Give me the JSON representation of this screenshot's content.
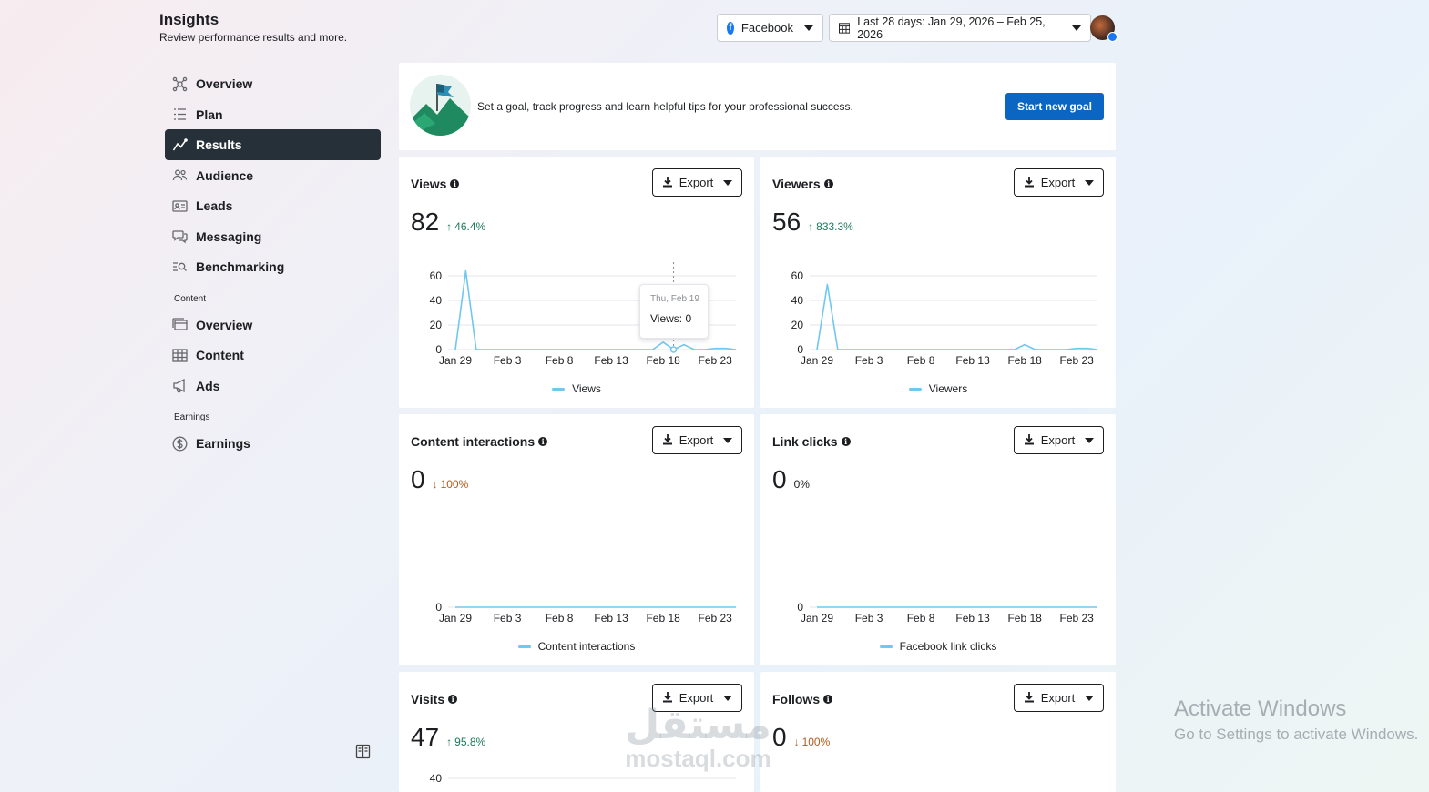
{
  "header": {
    "title": "Insights",
    "subtitle": "Review performance results and more.",
    "platform": "Facebook",
    "date_range": "Last 28 days: Jan 29, 2026 – Feb 25, 2026"
  },
  "sidebar": {
    "items": [
      {
        "label": "Overview",
        "icon": "overview-icon"
      },
      {
        "label": "Plan",
        "icon": "plan-icon"
      },
      {
        "label": "Results",
        "icon": "results-icon",
        "active": true
      },
      {
        "label": "Audience",
        "icon": "audience-icon"
      },
      {
        "label": "Leads",
        "icon": "leads-icon"
      },
      {
        "label": "Messaging",
        "icon": "messaging-icon"
      },
      {
        "label": "Benchmarking",
        "icon": "benchmarking-icon"
      }
    ],
    "content_section": "Content",
    "content_items": [
      {
        "label": "Overview",
        "icon": "content-overview-icon"
      },
      {
        "label": "Content",
        "icon": "table-icon"
      },
      {
        "label": "Ads",
        "icon": "megaphone-icon"
      }
    ],
    "earnings_section": "Earnings",
    "earnings_items": [
      {
        "label": "Earnings",
        "icon": "dollar-icon"
      }
    ]
  },
  "goal": {
    "text": "Set a goal, track progress and learn helpful tips for your professional success.",
    "button": "Start new goal"
  },
  "export_label": "Export",
  "metrics": {
    "views": {
      "title": "Views",
      "value": "82",
      "delta": "46.4%",
      "direction": "up",
      "legend": "Views",
      "tooltip": {
        "date": "Thu, Feb 19",
        "text": "Views: 0"
      }
    },
    "viewers": {
      "title": "Viewers",
      "value": "56",
      "delta": "833.3%",
      "direction": "up",
      "legend": "Viewers"
    },
    "content_interactions": {
      "title": "Content interactions",
      "value": "0",
      "delta": "100%",
      "direction": "down",
      "legend": "Content interactions"
    },
    "link_clicks": {
      "title": "Link clicks",
      "value": "0",
      "delta": "0%",
      "direction": "flat",
      "legend": "Facebook link clicks"
    },
    "visits": {
      "title": "Visits",
      "value": "47",
      "delta": "95.8%",
      "direction": "up"
    },
    "follows": {
      "title": "Follows",
      "value": "0",
      "delta": "100%",
      "direction": "down"
    }
  },
  "chart_data": [
    {
      "type": "line",
      "title": "Views",
      "x": [
        "Jan 29",
        "Jan 30",
        "Jan 31",
        "Feb 1",
        "Feb 2",
        "Feb 3",
        "Feb 4",
        "Feb 5",
        "Feb 6",
        "Feb 7",
        "Feb 8",
        "Feb 9",
        "Feb 10",
        "Feb 11",
        "Feb 12",
        "Feb 13",
        "Feb 14",
        "Feb 15",
        "Feb 16",
        "Feb 17",
        "Feb 18",
        "Feb 19",
        "Feb 20",
        "Feb 21",
        "Feb 22",
        "Feb 23",
        "Feb 24",
        "Feb 25"
      ],
      "tick_labels": [
        "Jan 29",
        "Feb 3",
        "Feb 8",
        "Feb 13",
        "Feb 18",
        "Feb 23"
      ],
      "series": [
        {
          "name": "Views",
          "values": [
            0,
            64,
            0,
            0,
            0,
            0,
            0,
            0,
            0,
            0,
            0,
            0,
            0,
            0,
            0,
            0,
            0,
            0,
            0,
            0,
            6,
            0,
            4,
            0,
            0,
            1,
            1,
            0
          ]
        }
      ],
      "ylim": [
        0,
        60
      ],
      "yticks": [
        0,
        20,
        40,
        60
      ]
    },
    {
      "type": "line",
      "title": "Viewers",
      "x": [
        "Jan 29",
        "Jan 30",
        "Jan 31",
        "Feb 1",
        "Feb 2",
        "Feb 3",
        "Feb 4",
        "Feb 5",
        "Feb 6",
        "Feb 7",
        "Feb 8",
        "Feb 9",
        "Feb 10",
        "Feb 11",
        "Feb 12",
        "Feb 13",
        "Feb 14",
        "Feb 15",
        "Feb 16",
        "Feb 17",
        "Feb 18",
        "Feb 19",
        "Feb 20",
        "Feb 21",
        "Feb 22",
        "Feb 23",
        "Feb 24",
        "Feb 25"
      ],
      "tick_labels": [
        "Jan 29",
        "Feb 3",
        "Feb 8",
        "Feb 13",
        "Feb 18",
        "Feb 23"
      ],
      "series": [
        {
          "name": "Viewers",
          "values": [
            0,
            53,
            0,
            0,
            0,
            0,
            0,
            0,
            0,
            0,
            0,
            0,
            0,
            0,
            0,
            0,
            0,
            0,
            0,
            0,
            4,
            0,
            0,
            0,
            0,
            1,
            1,
            0
          ]
        }
      ],
      "ylim": [
        0,
        60
      ],
      "yticks": [
        0,
        20,
        40,
        60
      ]
    },
    {
      "type": "line",
      "title": "Content interactions",
      "x": [
        "Jan 29",
        "Feb 25"
      ],
      "tick_labels": [
        "Jan 29",
        "Feb 3",
        "Feb 8",
        "Feb 13",
        "Feb 18",
        "Feb 23"
      ],
      "series": [
        {
          "name": "Content interactions",
          "values": [
            0,
            0
          ]
        }
      ],
      "ylim": [
        0,
        0
      ],
      "yticks": [
        0
      ]
    },
    {
      "type": "line",
      "title": "Link clicks",
      "x": [
        "Jan 29",
        "Feb 25"
      ],
      "tick_labels": [
        "Jan 29",
        "Feb 3",
        "Feb 8",
        "Feb 13",
        "Feb 18",
        "Feb 23"
      ],
      "series": [
        {
          "name": "Facebook link clicks",
          "values": [
            0,
            0
          ]
        }
      ],
      "ylim": [
        0,
        0
      ],
      "yticks": [
        0
      ]
    }
  ],
  "overlay": {
    "activate_title": "Activate Windows",
    "activate_sub": "Go to Settings to activate Windows.",
    "mostaql_ar": "مستقل",
    "mostaql_lat": "mostaql.com"
  },
  "colors": {
    "line": "#6fc8f0",
    "accent": "#0a66c2",
    "active_nav": "#263038",
    "up": "#1f7a5a",
    "down": "#b35a1a"
  }
}
